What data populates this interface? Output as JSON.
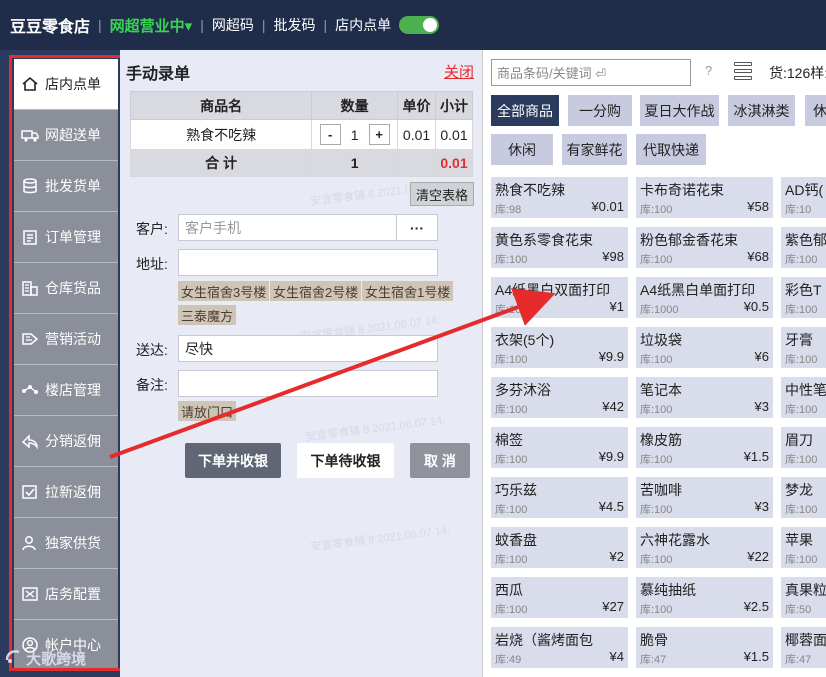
{
  "topbar": {
    "shop_name": "豆豆零食店",
    "status": "网超营业中▾",
    "links": [
      "网超码",
      "批发码",
      "店内点单"
    ]
  },
  "sidebar": {
    "items": [
      {
        "label": "店内点单",
        "icon": "home-icon"
      },
      {
        "label": "网超送单",
        "icon": "truck-icon"
      },
      {
        "label": "批发货单",
        "icon": "database-icon"
      },
      {
        "label": "订单管理",
        "icon": "clipboard-icon"
      },
      {
        "label": "仓库货品",
        "icon": "building-icon"
      },
      {
        "label": "营销活动",
        "icon": "tag-icon"
      },
      {
        "label": "楼店管理",
        "icon": "network-icon"
      },
      {
        "label": "分销返佣",
        "icon": "share-icon"
      },
      {
        "label": "拉新返佣",
        "icon": "check-badge-icon"
      },
      {
        "label": "独家供货",
        "icon": "user-icon"
      },
      {
        "label": "店务配置",
        "icon": "settings-icon"
      },
      {
        "label": "帐户中心",
        "icon": "account-icon"
      }
    ],
    "watermark_logo": "大歌跨境"
  },
  "form": {
    "title": "手动录单",
    "close": "关闭",
    "table": {
      "headers": [
        "商品名",
        "数量",
        "单价",
        "小计"
      ],
      "rows": [
        {
          "name": "熟食不吃辣",
          "qty": "1",
          "price": "0.01",
          "subtotal": "0.01"
        }
      ],
      "total_label": "合 计",
      "total_qty": "1",
      "total_amount": "0.01"
    },
    "clear_table": "清空表格",
    "customer_label": "客户:",
    "customer_placeholder": "客户手机",
    "more": "···",
    "address_label": "地址:",
    "address_value": "",
    "address_tags": [
      "女生宿舍3号楼",
      "女生宿舍2号楼",
      "女生宿舍1号楼",
      "三泰魔方"
    ],
    "delivery_label": "送达:",
    "delivery_value": "尽快",
    "note_label": "备注:",
    "note_value": "",
    "note_tags": [
      "请放门口"
    ],
    "btn_order_pay": "下单并收银",
    "btn_order_wait": "下单待收银",
    "btn_cancel": "取 消",
    "watermarks": [
      "安宜零食铺 8 2021.06.07 1",
      "安宜零食铺 8 2021.06.07 14:",
      "安宜零食铺 8 2021.06.07 14:",
      "安宜零食铺 8 2021.06.07 14:"
    ]
  },
  "catalog": {
    "search_placeholder": "商品条码/关键词 ⏎",
    "help": "?",
    "stock_summary": "货:126样:",
    "categories": [
      "全部商品",
      "一分购",
      "夏日大作战",
      "冰淇淋类",
      "休",
      "休闲",
      "有家鲜花",
      "代取快递"
    ],
    "products": [
      {
        "name": "熟食不吃辣",
        "stock": "库:98",
        "price": "¥0.01"
      },
      {
        "name": "卡布奇诺花束",
        "stock": "库:100",
        "price": "¥58"
      },
      {
        "name": "AD钙(",
        "stock": "库:10",
        "price": ""
      },
      {
        "name": "黄色系零食花束",
        "stock": "库:100",
        "price": "¥98"
      },
      {
        "name": "粉色郁金香花束",
        "stock": "库:100",
        "price": "¥68"
      },
      {
        "name": "紫色郁",
        "stock": "库:100",
        "price": ""
      },
      {
        "name": "A4纸黑白双面打印",
        "stock": "库:100",
        "price": "¥1"
      },
      {
        "name": "A4纸黑白单面打印",
        "stock": "库:1000",
        "price": "¥0.5"
      },
      {
        "name": "彩色T",
        "stock": "库:100",
        "price": ""
      },
      {
        "name": "衣架(5个)",
        "stock": "库:100",
        "price": "¥9.9"
      },
      {
        "name": "垃圾袋",
        "stock": "库:100",
        "price": "¥6"
      },
      {
        "name": "牙膏",
        "stock": "库:100",
        "price": ""
      },
      {
        "name": "多芬沐浴",
        "stock": "库:100",
        "price": "¥42"
      },
      {
        "name": "笔记本",
        "stock": "库:100",
        "price": "¥3"
      },
      {
        "name": "中性笔",
        "stock": "库:100",
        "price": ""
      },
      {
        "name": "棉签",
        "stock": "库:100",
        "price": "¥9.9"
      },
      {
        "name": "橡皮筋",
        "stock": "库:100",
        "price": "¥1.5"
      },
      {
        "name": "眉刀",
        "stock": "库:100",
        "price": ""
      },
      {
        "name": "巧乐兹",
        "stock": "库:100",
        "price": "¥4.5"
      },
      {
        "name": "苦咖啡",
        "stock": "库:100",
        "price": "¥3"
      },
      {
        "name": "梦龙",
        "stock": "库:100",
        "price": ""
      },
      {
        "name": "蚊香盘",
        "stock": "库:100",
        "price": "¥2"
      },
      {
        "name": "六神花露水",
        "stock": "库:100",
        "price": "¥22"
      },
      {
        "name": "苹果",
        "stock": "库:100",
        "price": ""
      },
      {
        "name": "西瓜",
        "stock": "库:100",
        "price": "¥27"
      },
      {
        "name": "慕纯抽纸",
        "stock": "库:100",
        "price": "¥2.5"
      },
      {
        "name": "真果粒",
        "stock": "库:50",
        "price": ""
      },
      {
        "name": "岩烧（酱烤面包",
        "stock": "库:49",
        "price": "¥4"
      },
      {
        "name": "脆骨",
        "stock": "库:47",
        "price": "¥1.5"
      },
      {
        "name": "椰蓉面",
        "stock": "库:47",
        "price": ""
      }
    ]
  },
  "colors": {
    "accent_red": "#e52b2b",
    "nav_dark": "#2b3b5e",
    "status_green": "#39d353"
  }
}
